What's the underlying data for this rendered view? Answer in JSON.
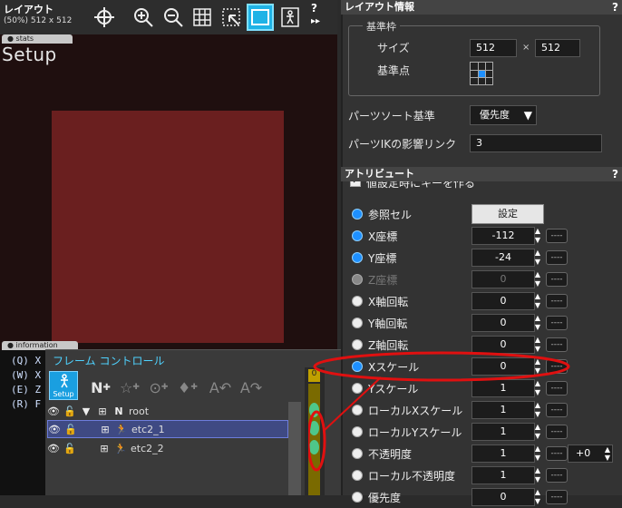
{
  "layout_panel": {
    "title": "レイアウト",
    "size_label": "(50%) 512 x 512",
    "stats_tab": "stats",
    "setup_text": "Setup",
    "info_tab": "information",
    "info_lines": [
      "(Q) X",
      "(W) X",
      "(E) Z",
      "(R) F"
    ],
    "help": "?",
    "play": "▸▸"
  },
  "frame_control": {
    "title": "フレーム コントロール",
    "setup_button": "Setup",
    "rows": [
      {
        "label": "root",
        "type": "N"
      },
      {
        "label": "etc2_1"
      },
      {
        "label": "etc2_2"
      }
    ],
    "timeline_frame": "0"
  },
  "layout_info": {
    "title": "レイアウト情報",
    "help": "?",
    "frame_group_title": "基準枠",
    "size_label": "サイズ",
    "width": "512",
    "times": "×",
    "height": "512",
    "pivot_label": "基準点",
    "sort_label": "パーツソート基準",
    "sort_value": "優先度",
    "ik_label": "パーツIKの影響リンク",
    "ik_value": "3"
  },
  "attributes": {
    "title": "アトリビュート",
    "help": "?",
    "partial_checkbox_label": "値設定時にキーを作る",
    "ref_cell_label": "参照セル",
    "ref_cell_button": "設定",
    "rows": [
      {
        "name": "X座標",
        "value": "-112",
        "key": "----"
      },
      {
        "name": "Y座標",
        "value": "-24",
        "key": "----"
      },
      {
        "name": "Z座標",
        "value": "0",
        "key": "----"
      },
      {
        "name": "X軸回転",
        "value": "0",
        "key": "----"
      },
      {
        "name": "Y軸回転",
        "value": "0",
        "key": "----"
      },
      {
        "name": "Z軸回転",
        "value": "0",
        "key": "----"
      },
      {
        "name": "Xスケール",
        "value": "0",
        "key": "----"
      },
      {
        "name": "Yスケール",
        "value": "1",
        "key": "----"
      },
      {
        "name": "ローカルXスケール",
        "value": "1",
        "key": "----"
      },
      {
        "name": "ローカルYスケール",
        "value": "1",
        "key": "----"
      },
      {
        "name": "不透明度",
        "value": "1",
        "key": "----",
        "extra": "+0"
      },
      {
        "name": "ローカル不透明度",
        "value": "1",
        "key": "----"
      },
      {
        "name": "優先度",
        "value": "0",
        "key": "----"
      }
    ]
  },
  "colors": {
    "accent_blue": "#1e90ff",
    "annotation_red": "#e01010",
    "frame_fill": "#6a1f1f"
  }
}
